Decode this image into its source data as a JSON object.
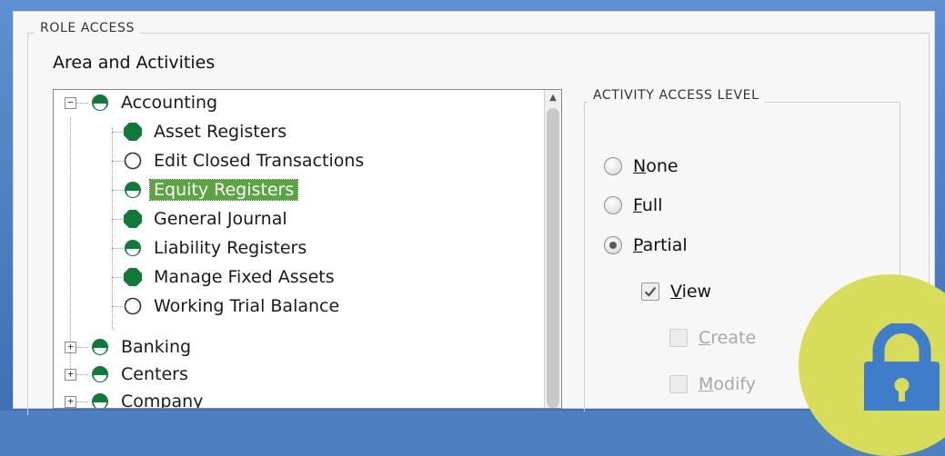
{
  "role_access": {
    "legend": "ROLE ACCESS"
  },
  "area": {
    "label": "Area and Activities"
  },
  "tree": {
    "root": {
      "label": "Accounting",
      "expanded": true,
      "access": "partial"
    },
    "children": [
      {
        "label": "Asset Registers",
        "access": "full"
      },
      {
        "label": "Edit Closed Transactions",
        "access": "none"
      },
      {
        "label": "Equity Registers",
        "access": "partial",
        "selected": true
      },
      {
        "label": "General Journal",
        "access": "full"
      },
      {
        "label": "Liability Registers",
        "access": "partial"
      },
      {
        "label": "Manage Fixed Assets",
        "access": "full"
      },
      {
        "label": "Working Trial Balance",
        "access": "none"
      }
    ],
    "siblings": [
      {
        "label": "Banking",
        "access": "partial"
      },
      {
        "label": "Centers",
        "access": "partial"
      },
      {
        "label": "Company",
        "access": "partial"
      }
    ]
  },
  "activity_access": {
    "legend": "ACTIVITY ACCESS LEVEL",
    "options": [
      {
        "label": "None",
        "mnemonic": "N",
        "rest": "one",
        "selected": false
      },
      {
        "label": "Full",
        "mnemonic": "F",
        "rest": "ull",
        "selected": false
      },
      {
        "label": "Partial",
        "mnemonic": "P",
        "rest": "artial",
        "selected": true
      }
    ],
    "permissions": [
      {
        "label": "View",
        "mnemonic": "V",
        "rest": "iew",
        "checked": true,
        "enabled": true
      },
      {
        "label": "Create",
        "mnemonic": "C",
        "rest": "reate",
        "checked": false,
        "enabled": false
      },
      {
        "label": "Modify",
        "mnemonic": "M",
        "rest": "odify",
        "checked": false,
        "enabled": false
      }
    ]
  },
  "colors": {
    "access_green": "#0f7a3a",
    "selection": "#5aa542",
    "badge": "#d7dd5a",
    "lock": "#3f7cc9"
  },
  "icons": {
    "lock": "lock-icon"
  }
}
